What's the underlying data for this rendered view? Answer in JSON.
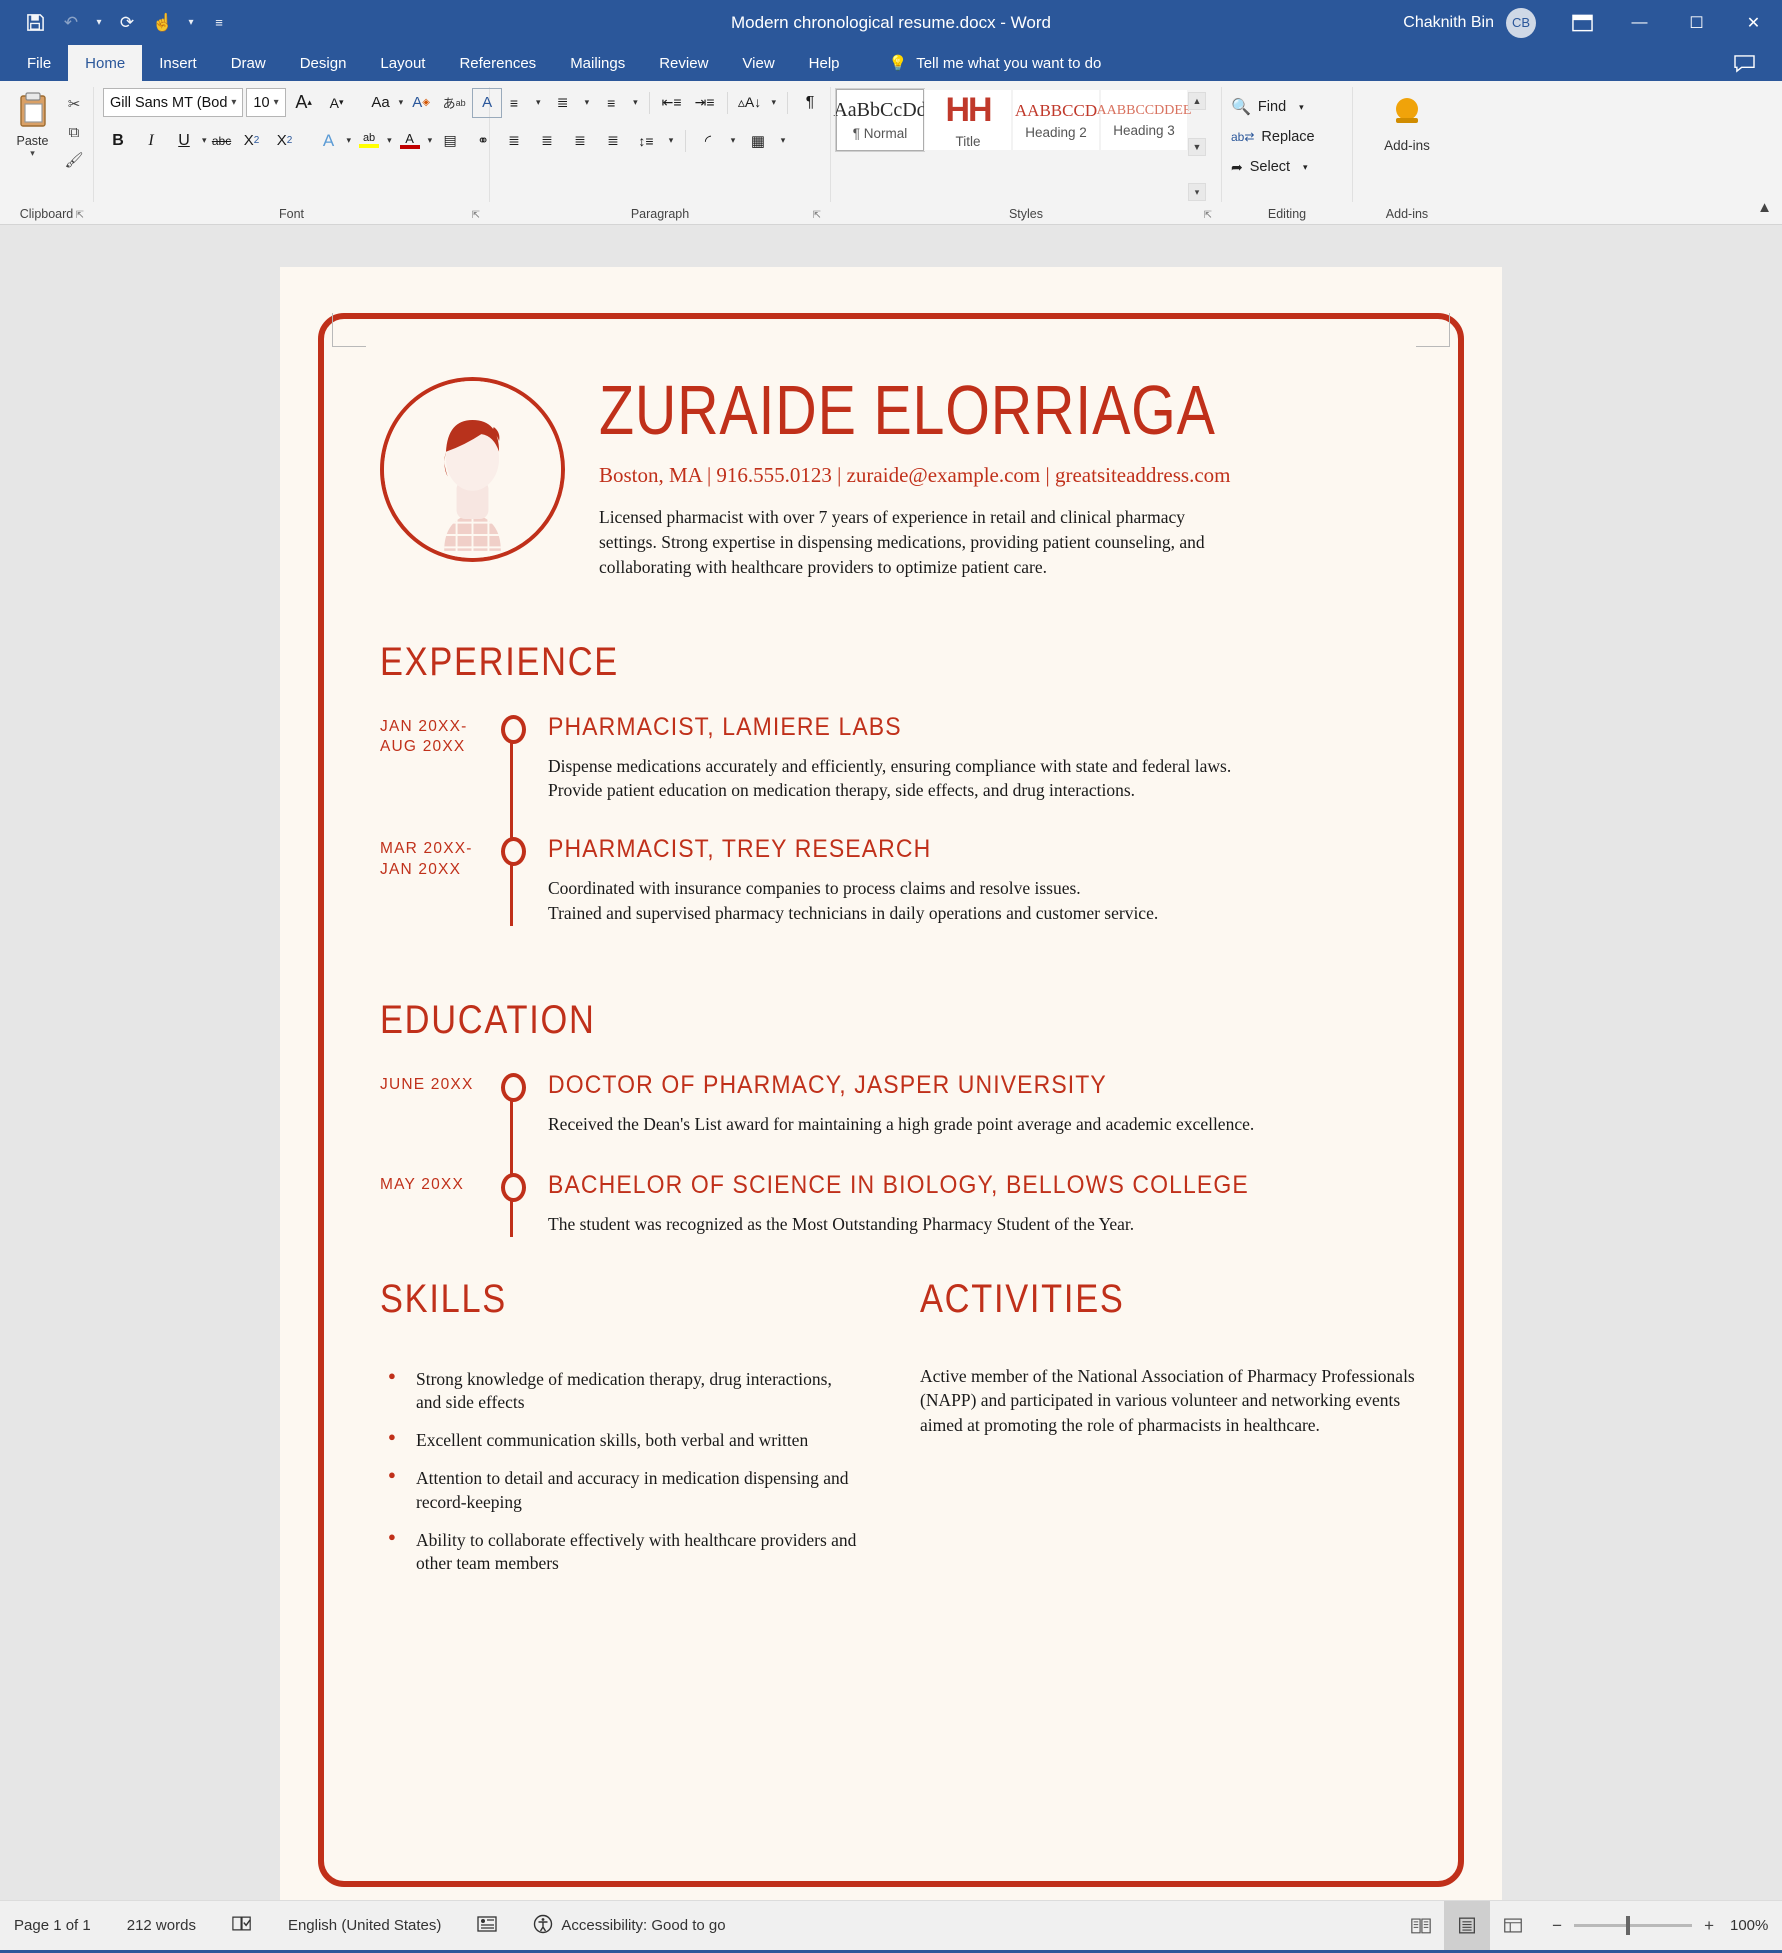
{
  "titlebar": {
    "document_title": "Modern chronological resume.docx  -  Word",
    "user_name": "Chaknith Bin",
    "avatar_initials": "CB",
    "quick_access": [
      {
        "name": "save-icon",
        "glyph": "Ὃe"
      },
      {
        "name": "undo-icon",
        "glyph": "↶"
      },
      {
        "name": "redo-icon",
        "glyph": "↻"
      },
      {
        "name": "touch-mode-icon",
        "glyph": "☝"
      },
      {
        "name": "qat-overflow-icon",
        "glyph": "☰"
      }
    ],
    "window_controls": {
      "ribbon_display": "⌧",
      "minimize": "−",
      "maximize": "☐",
      "close": "✕"
    }
  },
  "ribbon_tabs": {
    "items": [
      "File",
      "Home",
      "Insert",
      "Draw",
      "Design",
      "Layout",
      "References",
      "Mailings",
      "Review",
      "View",
      "Help"
    ],
    "active": "Home",
    "tell_me": "Tell me what you want to do"
  },
  "ribbon": {
    "clipboard": {
      "label": "Clipboard",
      "paste_label": "Paste",
      "cut_icon": "✂",
      "copy_icon": "⧉",
      "format_painter_icon": "✎"
    },
    "font": {
      "label": "Font",
      "font_name": "Gill Sans MT (Bod",
      "font_size": "10",
      "grow_font": "A",
      "shrink_font": "A",
      "change_case": "Aa",
      "clear_formatting": "Ⓐ",
      "bold": "B",
      "italic": "I",
      "underline": "U",
      "strikethrough": "abc",
      "subscript": "X₂",
      "superscript": "X²",
      "text_effects": "A",
      "highlight": "ab",
      "font_color": "A",
      "char_shading": "A",
      "char_border": "Ⓐ",
      "phonetic": "あ"
    },
    "paragraph": {
      "label": "Paragraph",
      "bullets": "•≡",
      "numbering": "≡",
      "multilevel": "≡",
      "decrease_indent": "←≡",
      "increase_indent": "→≡",
      "sort": "A↓",
      "show_marks": "¶",
      "align_left": "≡",
      "align_center": "≡",
      "align_right": "≡",
      "justify": "≡",
      "line_spacing": "↕≡",
      "shading": "▤",
      "borders": "⊞"
    },
    "styles": {
      "label": "Styles",
      "items": [
        {
          "preview": "AaBbCcDd",
          "name": "¶ Normal",
          "selected": true
        },
        {
          "preview": "HH",
          "name": "Title",
          "selected": false
        },
        {
          "preview": "AABBCCD",
          "name": "Heading 2",
          "selected": false
        },
        {
          "preview": "AABBCCDDEE",
          "name": "Heading 3",
          "selected": false
        }
      ]
    },
    "editing": {
      "label": "Editing",
      "find": "Find",
      "replace": "Replace",
      "select": "Select",
      "find_icon": "⚲",
      "replace_icon": "ab",
      "select_icon": "↖"
    },
    "addins": {
      "label": "Add-ins",
      "button_label": "Add-ins",
      "icon": "●"
    },
    "collapse_icon": "⌃"
  },
  "resume": {
    "name": "ZURAIDE ELORRIAGA",
    "contact": "Boston, MA | 916.555.0123 | zuraide@example.com | greatsiteaddress.com",
    "summary": "Licensed pharmacist with over 7 years of experience in retail and clinical pharmacy settings. Strong expertise in dispensing medications, providing patient counseling, and collaborating with healthcare providers to optimize patient care.",
    "experience": {
      "heading": "EXPERIENCE",
      "entries": [
        {
          "date": "JAN 20XX-\nAUG 20XX",
          "title": "PHARMACIST, LAMIERE LABS",
          "description": "Dispense medications accurately and efficiently, ensuring compliance with state and federal laws.\nProvide patient education on medication therapy, side effects, and drug interactions."
        },
        {
          "date": "MAR 20XX-\nJAN 20XX",
          "title": "PHARMACIST, TREY RESEARCH",
          "description": "Coordinated with insurance companies to process claims and resolve issues.\nTrained and supervised pharmacy technicians in daily operations and customer service."
        }
      ]
    },
    "education": {
      "heading": "EDUCATION",
      "entries": [
        {
          "date": "JUNE 20XX",
          "title": "DOCTOR OF PHARMACY, JASPER UNIVERSITY",
          "description": "Received the Dean's List award for maintaining a high grade point average and academic excellence."
        },
        {
          "date": "MAY 20XX",
          "title": "BACHELOR OF SCIENCE IN BIOLOGY, BELLOWS COLLEGE",
          "description": "The student was recognized as the Most Outstanding Pharmacy Student of the Year."
        }
      ]
    },
    "skills": {
      "heading": "SKILLS",
      "items": [
        "Strong knowledge of medication therapy, drug interactions, and side effects",
        "Excellent communication skills, both verbal and written",
        "Attention to detail and accuracy in medication dispensing and record-keeping",
        "Ability to collaborate effectively with healthcare providers and other team members"
      ]
    },
    "activities": {
      "heading": "ACTIVITIES",
      "body": "Active member of the National Association of Pharmacy Professionals (NAPP) and participated in various volunteer and networking events aimed at promoting the role of pharmacists in healthcare."
    },
    "accent_color": "#c0301a",
    "page_color": "#fdf8f1"
  },
  "statusbar": {
    "page": "Page 1 of 1",
    "words": "212 words",
    "proofing_icon": "☑",
    "language": "English (United States)",
    "dictate_icon": "▤",
    "accessibility_icon": "☼",
    "accessibility": "Accessibility: Good to go",
    "views": [
      {
        "name": "read-mode-view",
        "glyph": "⌸",
        "active": false
      },
      {
        "name": "print-layout-view",
        "glyph": "☰",
        "active": true
      },
      {
        "name": "web-layout-view",
        "glyph": "⧉",
        "active": false
      }
    ],
    "zoom_out": "−",
    "zoom_in": "+",
    "zoom_value": "100%"
  }
}
